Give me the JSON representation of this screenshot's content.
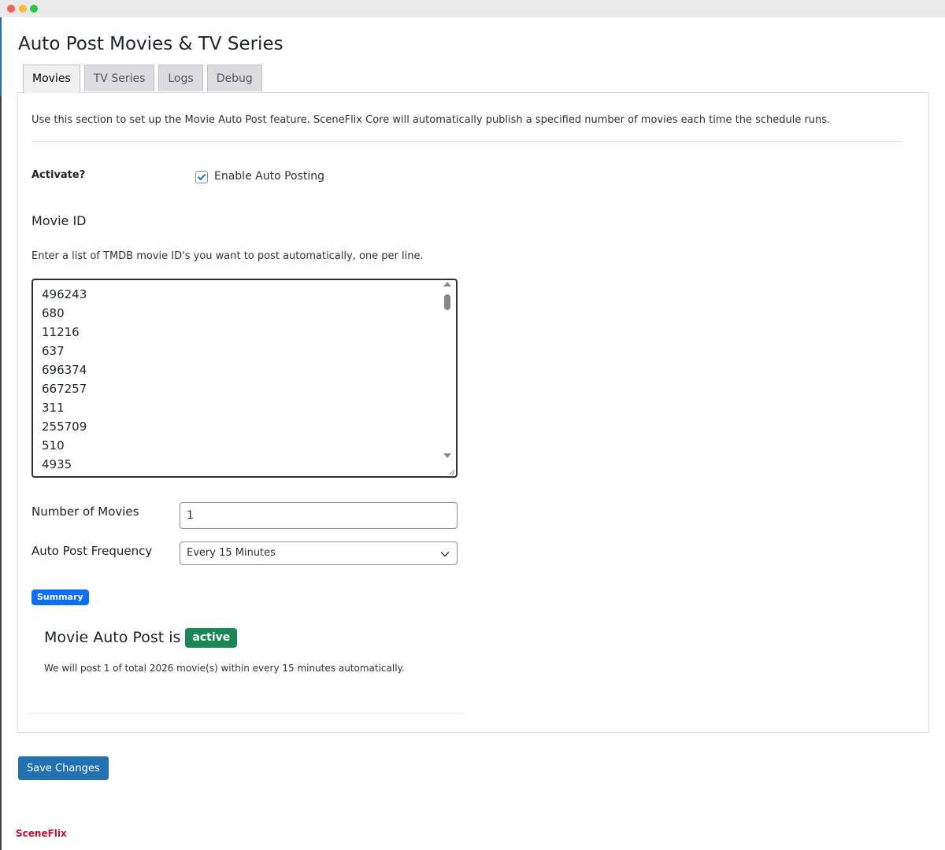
{
  "page": {
    "title": "Auto Post Movies & TV Series"
  },
  "tabs": [
    {
      "label": "Movies",
      "active": true
    },
    {
      "label": "TV Series",
      "active": false
    },
    {
      "label": "Logs",
      "active": false
    },
    {
      "label": "Debug",
      "active": false
    }
  ],
  "intro": "Use this section to set up the Movie Auto Post feature. SceneFlix Core will automatically publish a specified number of movies each time the schedule runs.",
  "activate": {
    "label": "Activate?",
    "checkbox_label": "Enable Auto Posting",
    "checked": true
  },
  "movie_id": {
    "heading": "Movie ID",
    "description": "Enter a list of TMDB movie ID's you want to post automatically, one per line.",
    "visible_lines": [
      "496243",
      "680",
      "11216",
      "637",
      "696374",
      "667257",
      "311",
      "255709",
      "510",
      "4935"
    ]
  },
  "number_of_movies": {
    "label": "Number of Movies",
    "value": "1"
  },
  "frequency": {
    "label": "Auto Post Frequency",
    "selected": "Every 15 Minutes"
  },
  "summary": {
    "badge": "Summary",
    "heading": "Movie Auto Post is",
    "status": "active",
    "text": "We will post 1 of total 2026 movie(s) within every 15 minutes automatically."
  },
  "actions": {
    "save_label": "Save Changes"
  },
  "footer": {
    "brand": "SceneFlix"
  },
  "colors": {
    "primary": "#2271b1",
    "summary_badge": "#0d6efd",
    "status_active": "#198754",
    "brand": "#c8102e"
  }
}
